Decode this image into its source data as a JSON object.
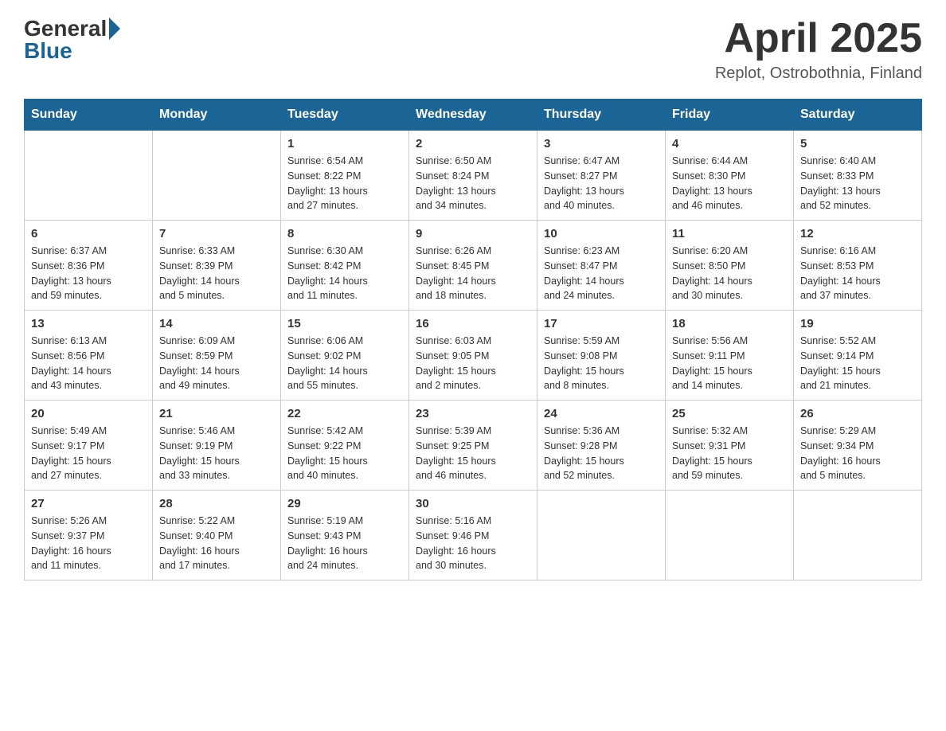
{
  "header": {
    "logo_general": "General",
    "logo_blue": "Blue",
    "month_title": "April 2025",
    "location": "Replot, Ostrobothnia, Finland"
  },
  "days_of_week": [
    "Sunday",
    "Monday",
    "Tuesday",
    "Wednesday",
    "Thursday",
    "Friday",
    "Saturday"
  ],
  "weeks": [
    [
      {
        "day": "",
        "info": ""
      },
      {
        "day": "",
        "info": ""
      },
      {
        "day": "1",
        "info": "Sunrise: 6:54 AM\nSunset: 8:22 PM\nDaylight: 13 hours\nand 27 minutes."
      },
      {
        "day": "2",
        "info": "Sunrise: 6:50 AM\nSunset: 8:24 PM\nDaylight: 13 hours\nand 34 minutes."
      },
      {
        "day": "3",
        "info": "Sunrise: 6:47 AM\nSunset: 8:27 PM\nDaylight: 13 hours\nand 40 minutes."
      },
      {
        "day": "4",
        "info": "Sunrise: 6:44 AM\nSunset: 8:30 PM\nDaylight: 13 hours\nand 46 minutes."
      },
      {
        "day": "5",
        "info": "Sunrise: 6:40 AM\nSunset: 8:33 PM\nDaylight: 13 hours\nand 52 minutes."
      }
    ],
    [
      {
        "day": "6",
        "info": "Sunrise: 6:37 AM\nSunset: 8:36 PM\nDaylight: 13 hours\nand 59 minutes."
      },
      {
        "day": "7",
        "info": "Sunrise: 6:33 AM\nSunset: 8:39 PM\nDaylight: 14 hours\nand 5 minutes."
      },
      {
        "day": "8",
        "info": "Sunrise: 6:30 AM\nSunset: 8:42 PM\nDaylight: 14 hours\nand 11 minutes."
      },
      {
        "day": "9",
        "info": "Sunrise: 6:26 AM\nSunset: 8:45 PM\nDaylight: 14 hours\nand 18 minutes."
      },
      {
        "day": "10",
        "info": "Sunrise: 6:23 AM\nSunset: 8:47 PM\nDaylight: 14 hours\nand 24 minutes."
      },
      {
        "day": "11",
        "info": "Sunrise: 6:20 AM\nSunset: 8:50 PM\nDaylight: 14 hours\nand 30 minutes."
      },
      {
        "day": "12",
        "info": "Sunrise: 6:16 AM\nSunset: 8:53 PM\nDaylight: 14 hours\nand 37 minutes."
      }
    ],
    [
      {
        "day": "13",
        "info": "Sunrise: 6:13 AM\nSunset: 8:56 PM\nDaylight: 14 hours\nand 43 minutes."
      },
      {
        "day": "14",
        "info": "Sunrise: 6:09 AM\nSunset: 8:59 PM\nDaylight: 14 hours\nand 49 minutes."
      },
      {
        "day": "15",
        "info": "Sunrise: 6:06 AM\nSunset: 9:02 PM\nDaylight: 14 hours\nand 55 minutes."
      },
      {
        "day": "16",
        "info": "Sunrise: 6:03 AM\nSunset: 9:05 PM\nDaylight: 15 hours\nand 2 minutes."
      },
      {
        "day": "17",
        "info": "Sunrise: 5:59 AM\nSunset: 9:08 PM\nDaylight: 15 hours\nand 8 minutes."
      },
      {
        "day": "18",
        "info": "Sunrise: 5:56 AM\nSunset: 9:11 PM\nDaylight: 15 hours\nand 14 minutes."
      },
      {
        "day": "19",
        "info": "Sunrise: 5:52 AM\nSunset: 9:14 PM\nDaylight: 15 hours\nand 21 minutes."
      }
    ],
    [
      {
        "day": "20",
        "info": "Sunrise: 5:49 AM\nSunset: 9:17 PM\nDaylight: 15 hours\nand 27 minutes."
      },
      {
        "day": "21",
        "info": "Sunrise: 5:46 AM\nSunset: 9:19 PM\nDaylight: 15 hours\nand 33 minutes."
      },
      {
        "day": "22",
        "info": "Sunrise: 5:42 AM\nSunset: 9:22 PM\nDaylight: 15 hours\nand 40 minutes."
      },
      {
        "day": "23",
        "info": "Sunrise: 5:39 AM\nSunset: 9:25 PM\nDaylight: 15 hours\nand 46 minutes."
      },
      {
        "day": "24",
        "info": "Sunrise: 5:36 AM\nSunset: 9:28 PM\nDaylight: 15 hours\nand 52 minutes."
      },
      {
        "day": "25",
        "info": "Sunrise: 5:32 AM\nSunset: 9:31 PM\nDaylight: 15 hours\nand 59 minutes."
      },
      {
        "day": "26",
        "info": "Sunrise: 5:29 AM\nSunset: 9:34 PM\nDaylight: 16 hours\nand 5 minutes."
      }
    ],
    [
      {
        "day": "27",
        "info": "Sunrise: 5:26 AM\nSunset: 9:37 PM\nDaylight: 16 hours\nand 11 minutes."
      },
      {
        "day": "28",
        "info": "Sunrise: 5:22 AM\nSunset: 9:40 PM\nDaylight: 16 hours\nand 17 minutes."
      },
      {
        "day": "29",
        "info": "Sunrise: 5:19 AM\nSunset: 9:43 PM\nDaylight: 16 hours\nand 24 minutes."
      },
      {
        "day": "30",
        "info": "Sunrise: 5:16 AM\nSunset: 9:46 PM\nDaylight: 16 hours\nand 30 minutes."
      },
      {
        "day": "",
        "info": ""
      },
      {
        "day": "",
        "info": ""
      },
      {
        "day": "",
        "info": ""
      }
    ]
  ]
}
